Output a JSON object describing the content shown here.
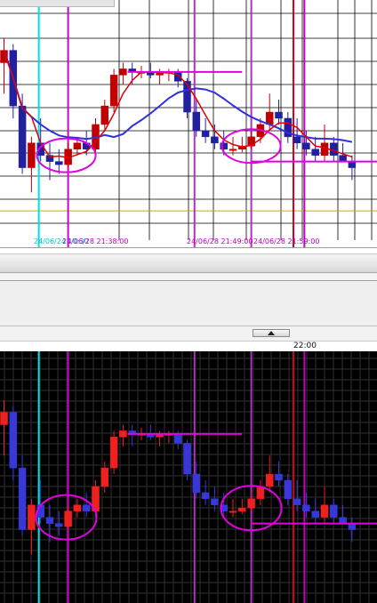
{
  "chart_data": [
    {
      "type": "candlestick",
      "panel": "upper",
      "overlays": [
        "moving-average-red",
        "moving-average-blue"
      ],
      "x_tick_labels": [
        {
          "text": "24/06/24 10:30",
          "color": "#00c8c8"
        },
        {
          "text": "24/06/28 21:38:00",
          "color": "#c000c0"
        },
        {
          "text": "24/06/28 21:49:00",
          "color": "#c000c0"
        },
        {
          "text": "24/06/28 21:59:00",
          "color": "#c000c0"
        }
      ],
      "candles": [
        {
          "o": 3,
          "h": 7,
          "l": -2,
          "c": 5
        },
        {
          "o": 5,
          "h": 6,
          "l": -6,
          "c": -4
        },
        {
          "o": -4,
          "h": -2,
          "l": -15,
          "c": -14
        },
        {
          "o": -14,
          "h": -9,
          "l": -18,
          "c": -10
        },
        {
          "o": -10,
          "h": -6,
          "l": -13,
          "c": -12
        },
        {
          "o": -12,
          "h": -10,
          "l": -16,
          "c": -13
        },
        {
          "o": -13,
          "h": -11,
          "l": -15,
          "c": -13.5
        },
        {
          "o": -13.5,
          "h": -10,
          "l": -14,
          "c": -11
        },
        {
          "o": -11,
          "h": -9,
          "l": -12,
          "c": -10
        },
        {
          "o": -10,
          "h": -8,
          "l": -12,
          "c": -11
        },
        {
          "o": -11,
          "h": -6,
          "l": -12,
          "c": -7
        },
        {
          "o": -7,
          "h": -3,
          "l": -8,
          "c": -4
        },
        {
          "o": -4,
          "h": 2,
          "l": -5,
          "c": 1
        },
        {
          "o": 1,
          "h": 3,
          "l": -0.5,
          "c": 2
        },
        {
          "o": 2,
          "h": 3,
          "l": -0.5,
          "c": 1.5
        },
        {
          "o": 1.5,
          "h": 2.5,
          "l": 0.5,
          "c": 1.5
        },
        {
          "o": 1.5,
          "h": 3,
          "l": 0.5,
          "c": 1
        },
        {
          "o": 1,
          "h": 2,
          "l": -0.5,
          "c": 1.5
        },
        {
          "o": 1.5,
          "h": 2,
          "l": 0,
          "c": 1.5
        },
        {
          "o": 1.5,
          "h": 2,
          "l": -1,
          "c": 0
        },
        {
          "o": 0,
          "h": 0.5,
          "l": -6,
          "c": -5
        },
        {
          "o": -5,
          "h": -3,
          "l": -9,
          "c": -8
        },
        {
          "o": -8,
          "h": -6,
          "l": -10,
          "c": -9
        },
        {
          "o": -9,
          "h": -7,
          "l": -11,
          "c": -10
        },
        {
          "o": -10,
          "h": -8,
          "l": -12,
          "c": -11
        },
        {
          "o": -11,
          "h": -9,
          "l": -12,
          "c": -11
        },
        {
          "o": -11,
          "h": -9,
          "l": -11.5,
          "c": -10.5
        },
        {
          "o": -10.5,
          "h": -8,
          "l": -11,
          "c": -9
        },
        {
          "o": -9,
          "h": -6,
          "l": -10,
          "c": -7
        },
        {
          "o": -7,
          "h": -2,
          "l": -8,
          "c": -5
        },
        {
          "o": -5,
          "h": -3,
          "l": -7,
          "c": -6
        },
        {
          "o": -6,
          "h": -5,
          "l": -10,
          "c": -9
        },
        {
          "o": -9,
          "h": -6,
          "l": -11,
          "c": -10
        },
        {
          "o": -10,
          "h": -8,
          "l": -12,
          "c": -11
        },
        {
          "o": -11,
          "h": -9,
          "l": -13,
          "c": -12
        },
        {
          "o": -12,
          "h": -7,
          "l": -13,
          "c": -10
        },
        {
          "o": -10,
          "h": -9,
          "l": -13,
          "c": -12
        },
        {
          "o": -12,
          "h": -10,
          "l": -13,
          "c": -13
        },
        {
          "o": -13,
          "h": -12,
          "l": -16,
          "c": -14
        }
      ],
      "ylim": [
        -24,
        12
      ],
      "colors": {
        "up": "#c00000",
        "down": "#2020a0",
        "ma_fast": "#e00000",
        "ma_slow": "#3030e0",
        "background": "#ffffff",
        "grid": "#000000"
      },
      "grid": true
    },
    {
      "type": "candlestick",
      "panel": "lower",
      "candles_same_as_upper": true,
      "ylim": [
        -24,
        12
      ],
      "colors": {
        "up": "#ee2020",
        "down": "#3838d8",
        "background": "#000000",
        "grid": "#303030"
      },
      "grid": true
    }
  ],
  "annotations": {
    "vertical_lines": [
      {
        "color": "#00e0e0",
        "candle": 3.8
      },
      {
        "color": "#d000d0",
        "candle": 7.0
      },
      {
        "color": "#b030c0",
        "candle": 20.8
      },
      {
        "color": "#b030c0",
        "candle": 27.0
      },
      {
        "color": "#d00020",
        "candle": 31.6
      },
      {
        "color": "#c000c0",
        "candle": 32.8
      }
    ],
    "ellipses": [
      {
        "color": "#e000e0",
        "candle_center": 6.8,
        "value_center": -12
      },
      {
        "color": "#e000e0",
        "candle_center": 27.0,
        "value_center": -10.5
      }
    ],
    "horizontal_segments": [
      {
        "color": "#e000e0",
        "from_candle": 13.5,
        "to_candle": 26.0,
        "value": 1.5
      },
      {
        "color": "#e000e0",
        "from_candle": 27.0,
        "to_candle": 42.0,
        "value": -13
      }
    ],
    "reference_line": {
      "color": "#e0a000",
      "value": -21
    }
  },
  "time_axis": {
    "label": "22:00"
  },
  "ui": {
    "scroll_up_icon": "triangle-up-icon"
  }
}
